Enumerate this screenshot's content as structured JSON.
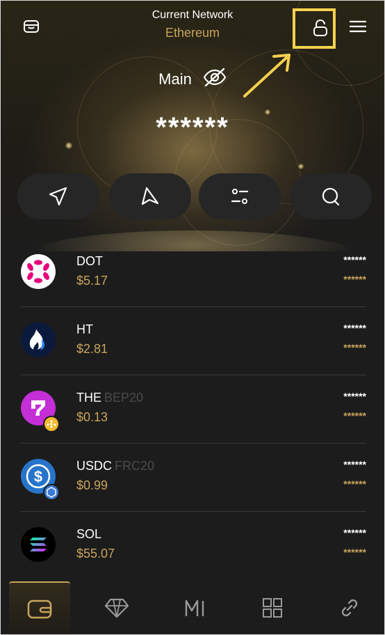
{
  "header": {
    "network_label": "Current Network",
    "network_value": "Ethereum",
    "left_icon": "wallet-card-icon",
    "lock_icon": "unlock-icon",
    "menu_icon": "hamburger-menu-icon"
  },
  "wallet": {
    "name": "Main",
    "visibility_icon": "eye-off-icon",
    "balance": "******"
  },
  "actions": [
    {
      "icon": "send-icon"
    },
    {
      "icon": "receive-icon"
    },
    {
      "icon": "swap-icon"
    },
    {
      "icon": "search-icon"
    }
  ],
  "assets": [
    {
      "symbol": "DOT",
      "tag": "",
      "price": "$5.17",
      "amount": "******",
      "value": "******"
    },
    {
      "symbol": "HT",
      "tag": "",
      "price": "$2.81",
      "amount": "******",
      "value": "******"
    },
    {
      "symbol": "THE",
      "tag": "BEP20",
      "price": "$0.13",
      "amount": "******",
      "value": "******"
    },
    {
      "symbol": "USDC",
      "tag": "FRC20",
      "price": "$0.99",
      "amount": "******",
      "value": "******"
    },
    {
      "symbol": "SOL",
      "tag": "",
      "price": "$55.07",
      "amount": "******",
      "value": "******"
    }
  ],
  "nav": [
    {
      "icon": "wallet-icon",
      "active": true
    },
    {
      "icon": "diamond-icon",
      "active": false
    },
    {
      "icon": "bridge-icon",
      "active": false
    },
    {
      "icon": "apps-grid-icon",
      "active": false
    },
    {
      "icon": "link-icon",
      "active": false
    }
  ],
  "colors": {
    "accent": "#c9a55c",
    "highlight": "#f5d14e",
    "background": "#1c1c1c"
  }
}
